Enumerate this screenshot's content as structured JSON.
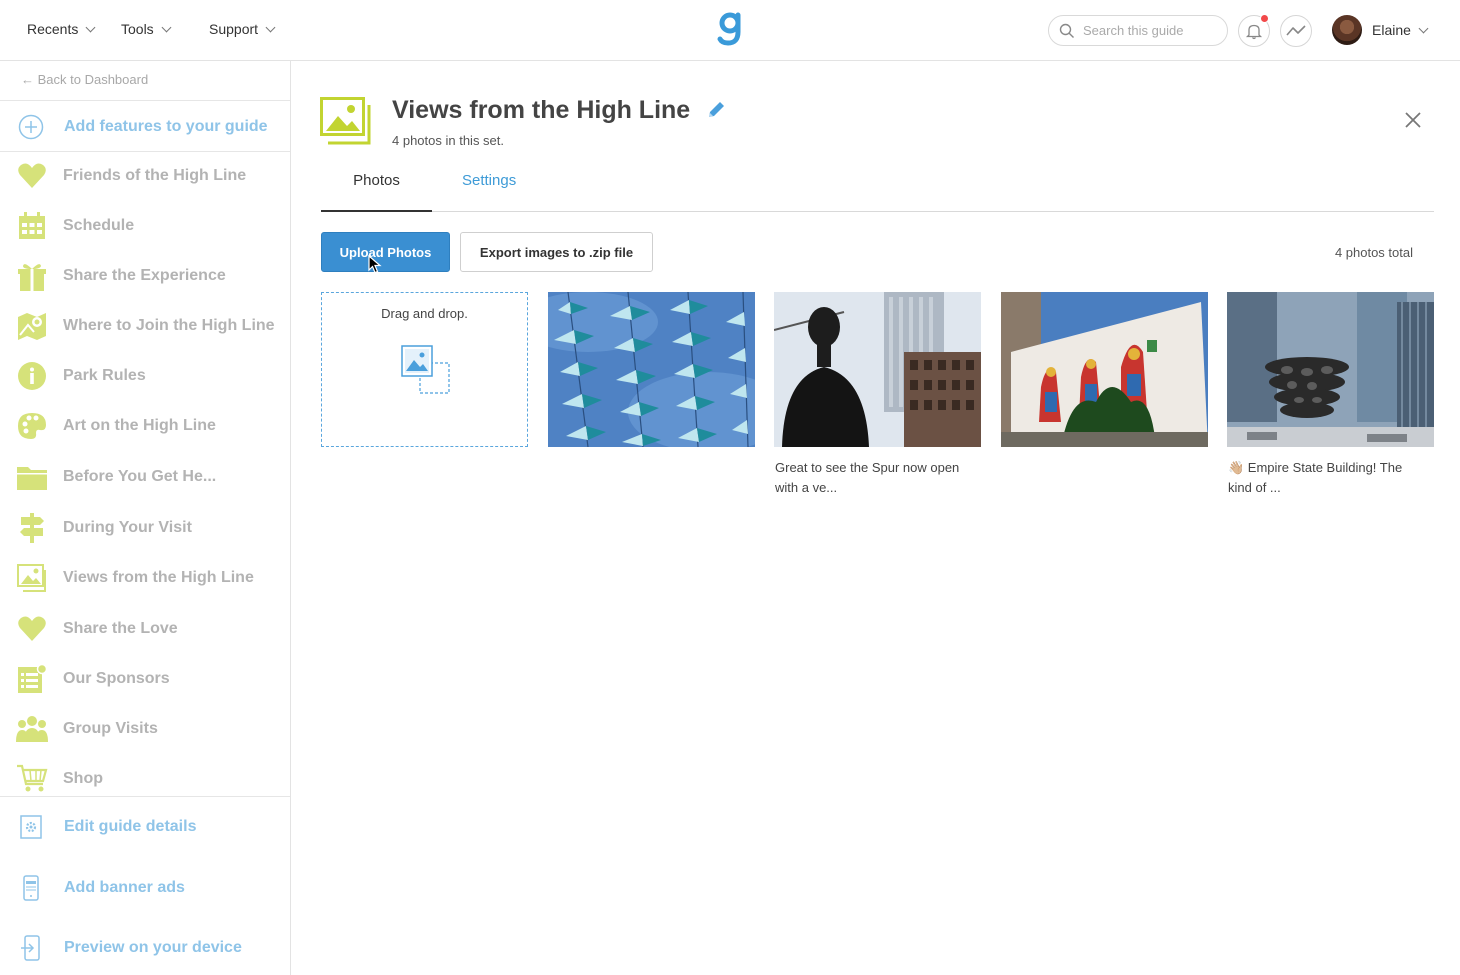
{
  "topbar": {
    "menus": [
      {
        "label": "Recents"
      },
      {
        "label": "Tools"
      },
      {
        "label": "Support"
      }
    ],
    "search_placeholder": "Search this guide",
    "user_name": "Elaine"
  },
  "sidebar": {
    "back_label": "← Back to Dashboard",
    "add_label": "Add features to your guide",
    "items": [
      {
        "label": "Friends of the High Line",
        "icon": "heart-icon"
      },
      {
        "label": "Schedule",
        "icon": "calendar-icon"
      },
      {
        "label": "Share the Experience",
        "icon": "gift-icon"
      },
      {
        "label": "Where to Join the High Line",
        "icon": "map-icon"
      },
      {
        "label": "Park Rules",
        "icon": "info-icon"
      },
      {
        "label": "Art on the High Line",
        "icon": "palette-icon"
      },
      {
        "label": "Before You Get He...",
        "icon": "folder-icon"
      },
      {
        "label": "During Your Visit",
        "icon": "signpost-icon"
      },
      {
        "label": "Views from the High Line",
        "icon": "image-icon"
      },
      {
        "label": "Share the Love",
        "icon": "heart-icon"
      },
      {
        "label": "Our Sponsors",
        "icon": "list-icon"
      },
      {
        "label": "Group Visits",
        "icon": "group-icon"
      },
      {
        "label": "Shop",
        "icon": "cart-icon"
      }
    ],
    "tools": [
      {
        "label": "Edit guide details",
        "icon": "gear-icon"
      },
      {
        "label": "Add banner ads",
        "icon": "device-icon"
      },
      {
        "label": "Preview on your device",
        "icon": "phone-arrow-icon"
      }
    ]
  },
  "main": {
    "title": "Views from the High Line",
    "subtitle": "4 photos in this set.",
    "tabs": [
      {
        "label": "Photos",
        "active": true
      },
      {
        "label": "Settings",
        "active": false
      }
    ],
    "upload_label": "Upload Photos",
    "export_label": "Export images to .zip file",
    "total_label": "4 photos total",
    "dropzone_label": "Drag and drop.",
    "photos": [
      {
        "caption": ""
      },
      {
        "caption": "Great to see the Spur now open with a ve..."
      },
      {
        "caption": ""
      },
      {
        "caption": "👋🏼 Empire State Building! The kind of ..."
      }
    ]
  },
  "colors": {
    "accent_blue": "#3a8fd2",
    "link_blue": "#3e9bd7",
    "sidebar_icon_green": "#d6e27a",
    "notification_red": "#f2494a"
  }
}
